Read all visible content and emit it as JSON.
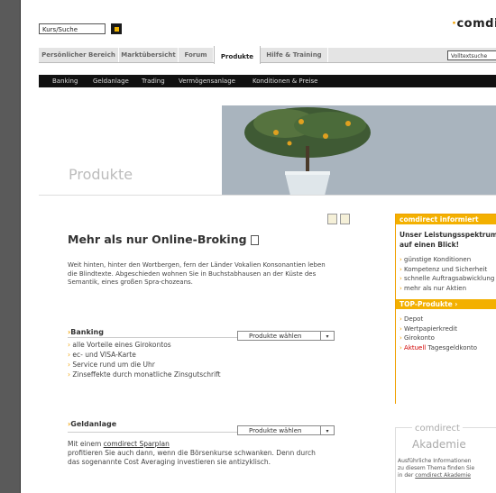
{
  "header": {
    "search_value": "Kurs/Suche",
    "logo_dot": "·",
    "logo_text": "comdirect"
  },
  "tabs": [
    {
      "label": "Persönlicher Bereich"
    },
    {
      "label": "Marktübersicht"
    },
    {
      "label": "Forum"
    },
    {
      "label": "Produkte"
    },
    {
      "label": "Hilfe & Training"
    }
  ],
  "fulltext_search": "Volltextsuche",
  "subnav": [
    "Banking",
    "Geldanlage",
    "Trading",
    "Vermögensanlage",
    "Konditionen & Preise"
  ],
  "banner": {
    "title": "Produkte"
  },
  "article": {
    "headline": "Mehr als nur Online-Broking",
    "intro": "Weit hinten, hinter den Wortbergen, fern der Länder Vokalien Konsonantien leben die Blindtexte. Abgeschieden wohnen Sie in Buchstabhausen an der Küste des Semantik, eines großen Spra-chozeans."
  },
  "sections": {
    "banking": {
      "title": "Banking",
      "select_label": "Produkte wählen",
      "items": [
        "alle Vorteile eines Girokontos",
        "ec- und VISA-Karte",
        "Service rund um die Uhr",
        "Zinseffekte durch monatliche Zinsgutschrift"
      ]
    },
    "geldanlage": {
      "title": "Geldanlage",
      "select_label": "Produkte wählen",
      "text_prefix": "Mit einem ",
      "link": "comdirect Sparplan",
      "text_rest": "profitieren Sie auch dann, wenn die Börsenkurse schwanken. Denn durch das sogenannte Cost Averaging investieren sie antizyklisch."
    }
  },
  "sidebar": {
    "informiert": {
      "header": "comdirect informiert",
      "heading": "Unser Leistungsspektrum auf einen Blick!",
      "items": [
        "günstige Konditionen",
        "Kompetenz und Sicherheit",
        "schnelle Auftragsabwicklung",
        "mehr als nur Aktien"
      ]
    },
    "top_produkte": {
      "header": "TOP-Produkte ›",
      "items": [
        "Depot",
        "Wertpapierkredit",
        "Girokonto"
      ],
      "highlight_red": "Aktuell",
      "highlight_rest": " Tagesgeldkonto"
    },
    "akademie": {
      "small": "comdirect",
      "big": "Akademie",
      "text_line1": "Ausführliche Informationen",
      "text_line2": "zu diesem Thema finden Sie",
      "text_prefix": "in der ",
      "text_link": "comdirect Akademie"
    }
  },
  "colors": {
    "accent": "#f3b000",
    "nav_bg": "#111111",
    "alert_red": "#d00000"
  },
  "icons": [
    "search-go-icon",
    "print-icon",
    "page-icon",
    "save-icon",
    "chevron-down-icon"
  ]
}
